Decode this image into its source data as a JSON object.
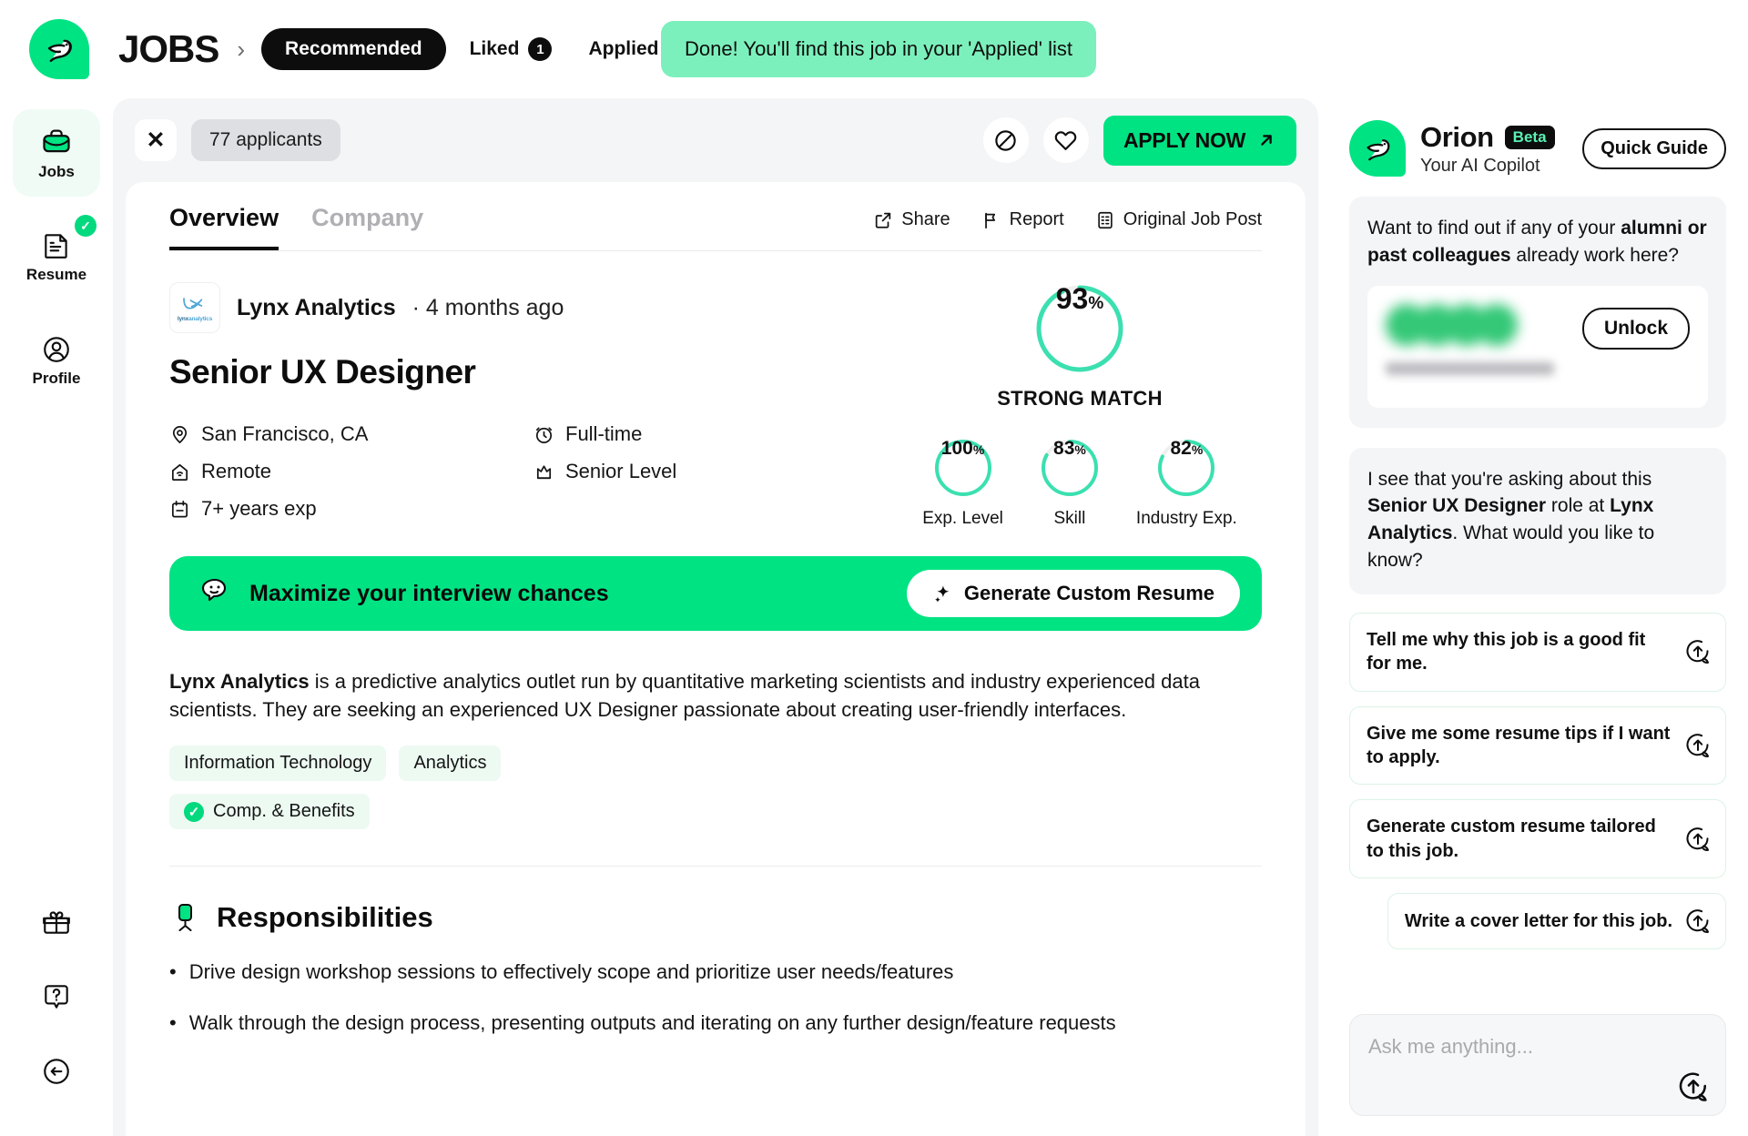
{
  "brand": {
    "logo_icon": "bird-logo-icon",
    "title": "JOBS"
  },
  "nav_tabs": [
    {
      "label": "Recommended",
      "active": true,
      "count": null
    },
    {
      "label": "Liked",
      "active": false,
      "count": "1"
    },
    {
      "label": "Applied",
      "active": false,
      "count": null
    }
  ],
  "toast": {
    "message": "Done! You'll find this job in your 'Applied' list",
    "bg": "#7CF0BC"
  },
  "rail": {
    "items": [
      {
        "label": "Jobs",
        "icon": "briefcase-icon",
        "active": true,
        "badge": null
      },
      {
        "label": "Resume",
        "icon": "document-icon",
        "active": false,
        "badge": "✓"
      },
      {
        "label": "Profile",
        "icon": "user-circle-icon",
        "active": false,
        "badge": null
      }
    ],
    "bottom_items": [
      {
        "icon": "gift-icon",
        "name": "gift-icon"
      },
      {
        "icon": "help-icon",
        "name": "help-icon"
      },
      {
        "icon": "back-arrow-icon",
        "name": "collapse-sidebar-icon"
      }
    ]
  },
  "job_actions": {
    "close_label": "✕",
    "applicants": "77 applicants",
    "not_interested_icon": "block-icon",
    "like_icon": "heart-icon",
    "apply_label": "APPLY NOW"
  },
  "card_tabs": [
    {
      "label": "Overview",
      "active": true
    },
    {
      "label": "Company",
      "active": false
    }
  ],
  "card_tools": [
    {
      "label": "Share",
      "icon": "share-icon"
    },
    {
      "label": "Report",
      "icon": "flag-icon"
    },
    {
      "label": "Original Job Post",
      "icon": "document-link-icon"
    }
  ],
  "job": {
    "company": "Lynx Analytics",
    "company_logo_text_1": "lynx",
    "company_logo_text_2": "analytics",
    "posted": "· 4 months ago",
    "title": "Senior UX Designer",
    "facts_col1": [
      {
        "icon": "location-pin-icon",
        "text": "San Francisco, CA"
      },
      {
        "icon": "remote-home-icon",
        "text": "Remote"
      },
      {
        "icon": "calendar-icon",
        "text": "7+ years exp"
      }
    ],
    "facts_col2": [
      {
        "icon": "clock-icon",
        "text": "Full-time"
      },
      {
        "icon": "crown-icon",
        "text": "Senior Level"
      }
    ],
    "description_lead": "Lynx Analytics",
    "description_rest": " is a predictive analytics outlet run by quantitative marketing scientists and industry experienced data scientists. They are seeking an experienced UX Designer passionate about creating user-friendly interfaces.",
    "tags": [
      "Information Technology",
      "Analytics"
    ],
    "benefit_tag": "Comp. & Benefits",
    "benefit_check": "✓"
  },
  "match": {
    "overall": {
      "value": 93,
      "display": "93",
      "symbol": "%",
      "label": "STRONG MATCH"
    },
    "sub_scores": [
      {
        "display": "100",
        "symbol": "%",
        "value": 100,
        "label": "Exp. Level"
      },
      {
        "display": "83",
        "symbol": "%",
        "value": 83,
        "label": "Skill"
      },
      {
        "display": "82",
        "symbol": "%",
        "value": 82,
        "label": "Industry Exp."
      }
    ],
    "ring_color": "#3BE0B0",
    "ring_track": "#F0EFEF"
  },
  "promo": {
    "text": "Maximize your interview chances",
    "button": "Generate Custom Resume",
    "icon": "smiley-chat-icon",
    "button_icon": "sparkle-icon",
    "bg": "#00E383"
  },
  "responsibilities": {
    "icon": "office-chair-icon",
    "title": "Responsibilities",
    "items": [
      "Drive design workshop sessions to effectively scope and prioritize user needs/features",
      "Walk through the design process, presenting outputs and iterating on any further design/feature requests"
    ]
  },
  "assistant": {
    "name": "Orion",
    "badge": "Beta",
    "subtitle": "Your AI Copilot",
    "quick_guide": "Quick Guide",
    "avatar_icon": "bird-logo-icon",
    "message1_part1": "Want to find out if any of your ",
    "message1_bold": "alumni or past colleagues",
    "message1_part2": " already work here?",
    "unlock_button": "Unlock",
    "message2_part1": "I see that you're asking about this ",
    "message2_bold1": "Senior UX Designer",
    "message2_part2": " role at ",
    "message2_bold2": "Lynx Analytics",
    "message2_part3": ". What would you like to know?",
    "suggestions": [
      {
        "text": "Tell me why this job is a good fit for me.",
        "align": "left"
      },
      {
        "text": "Give me some resume tips if I want to apply.",
        "align": "left"
      },
      {
        "text": "Generate custom resume tailored to this job.",
        "align": "left"
      },
      {
        "text": "Write a cover letter for this job.",
        "align": "right"
      }
    ],
    "composer_placeholder": "Ask me anything...",
    "send_icon": "send-chat-icon"
  },
  "colors": {
    "accent": "#00E383",
    "accent_soft": "#7CF0BC",
    "ring": "#3BE0B0",
    "dark": "#0d0d0d",
    "panel": "#F4F5F7"
  }
}
